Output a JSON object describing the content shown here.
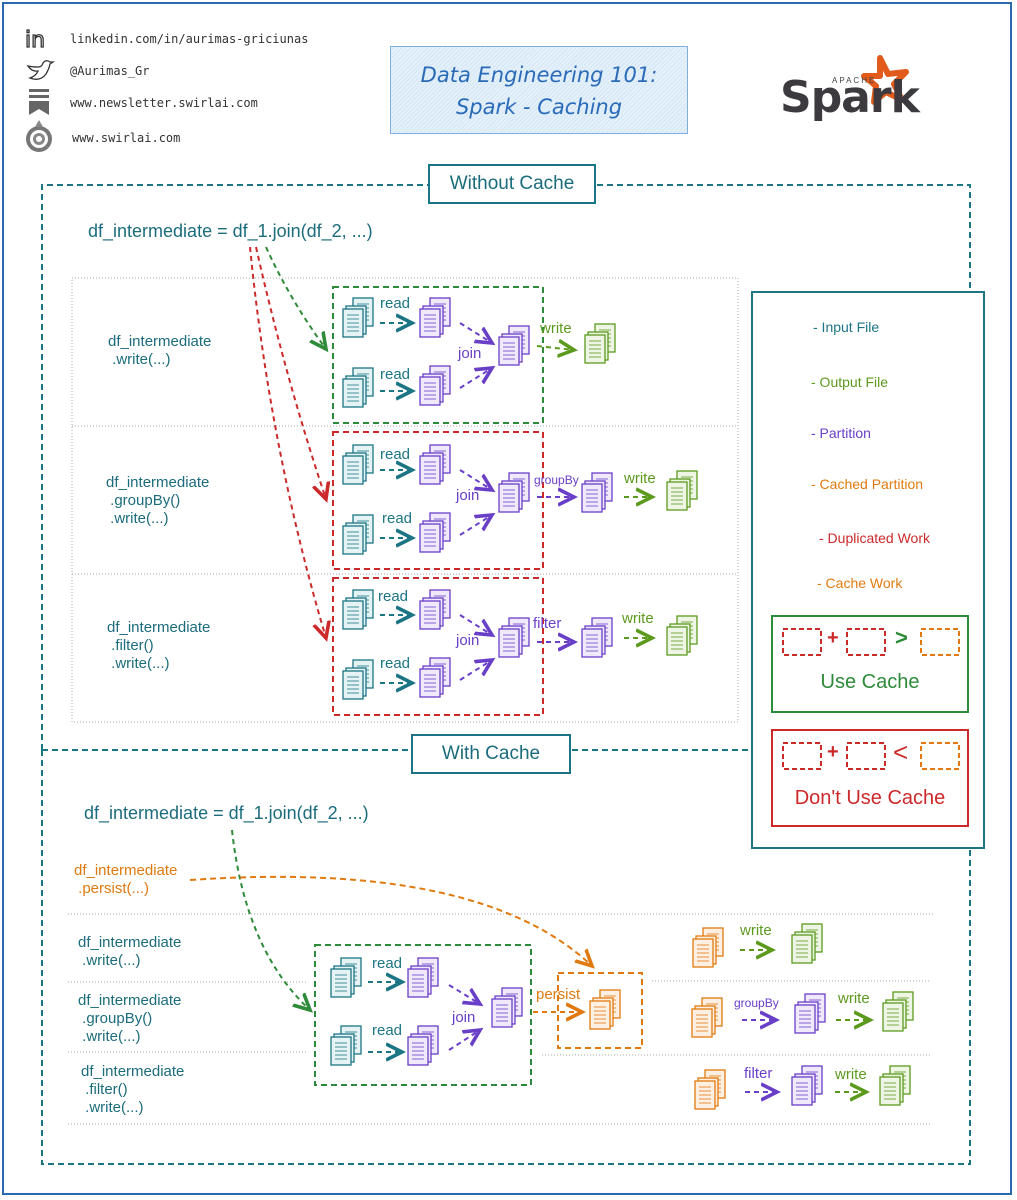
{
  "header": {
    "social": [
      {
        "icon": "linkedin-icon",
        "text": "linkedin.com/in/aurimas-griciunas"
      },
      {
        "icon": "twitter-icon",
        "text": "@Aurimas_Gr"
      },
      {
        "icon": "newsletter-icon",
        "text": "www.newsletter.swirlai.com"
      },
      {
        "icon": "swirlai-icon",
        "text": "www.swirlai.com"
      }
    ],
    "title_line1": "Data Engineering 101:",
    "title_line2": "Spark - Caching",
    "logo_small": "APACHE",
    "logo_main": "Spark"
  },
  "without_cache": {
    "section_label": "Without Cache",
    "definition": "df_intermediate = df_1.join(df_2, ...)",
    "rows": [
      {
        "code": [
          "df_intermediate",
          " .write(...)"
        ],
        "ops": [
          "read",
          "read",
          "join",
          "write"
        ]
      },
      {
        "code": [
          "df_intermediate",
          " .groupBy()",
          " .write(...)"
        ],
        "ops": [
          "read",
          "read",
          "join",
          "groupBy",
          "write"
        ]
      },
      {
        "code": [
          "df_intermediate",
          " .filter()",
          " .write(...)"
        ],
        "ops": [
          "read",
          "read",
          "join",
          "filter",
          "write"
        ]
      }
    ]
  },
  "with_cache": {
    "section_label": "With Cache",
    "definition": "df_intermediate = df_1.join(df_2, ...)",
    "persist_code": [
      "df_intermediate",
      " .persist(...)"
    ],
    "rows": [
      {
        "code": [
          "df_intermediate",
          " .write(...)"
        ],
        "ops": [
          "write"
        ]
      },
      {
        "code": [
          "df_intermediate",
          " .groupBy()",
          " .write(...)"
        ],
        "ops": [
          "groupBy",
          "write"
        ]
      },
      {
        "code": [
          "df_intermediate",
          " .filter()",
          " .write(...)"
        ],
        "ops": [
          "filter",
          "write"
        ]
      }
    ],
    "pipeline_ops": [
      "read",
      "read",
      "join",
      "persist"
    ]
  },
  "legend": {
    "items": [
      {
        "icon": "input-file-icon",
        "label": "- Input File",
        "color": "#1b7585"
      },
      {
        "icon": "output-file-icon",
        "label": "- Output File",
        "color": "#5c9a1e"
      },
      {
        "icon": "partition-icon",
        "label": "- Partition",
        "color": "#6a3fc8"
      },
      {
        "icon": "cached-partition-icon",
        "label": "- Cached Partition",
        "color": "#e07a10"
      },
      {
        "icon": "duplicated-work-box-icon",
        "label": "- Duplicated Work",
        "color": "#cc2a2a"
      },
      {
        "icon": "cache-work-box-icon",
        "label": "- Cache Work",
        "color": "#e07a10"
      }
    ],
    "use_cache": {
      "operator_plus": "+",
      "operator_compare": ">",
      "label": "Use Cache"
    },
    "dont_use_cache": {
      "operator_plus": "+",
      "operator_compare": "<",
      "label": "Don't Use Cache"
    }
  },
  "colors": {
    "teal": "#1b7585",
    "purple": "#6a3fc8",
    "green": "#5c9a1e",
    "dark_green": "#2e8b3a",
    "orange": "#e07a10",
    "red": "#cc2a2a",
    "frame_blue": "#2a6bb0"
  }
}
